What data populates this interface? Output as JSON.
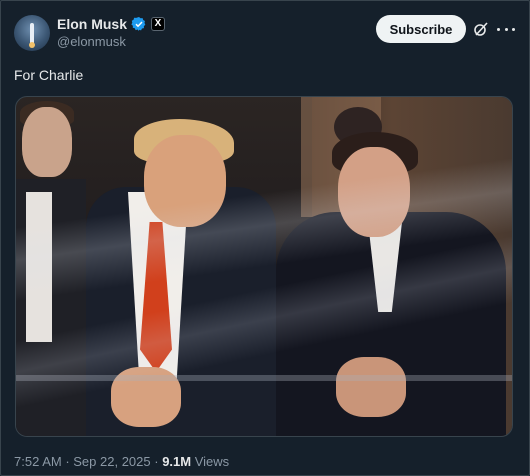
{
  "header": {
    "name": "Elon Musk",
    "handle": "@elonmusk",
    "x_badge": "X",
    "subscribe_label": "Subscribe",
    "icons": [
      "verified-badge-icon",
      "grok-icon",
      "more-icon"
    ],
    "accent_color": "#1d9bf0"
  },
  "tweet": {
    "text": "For Charlie"
  },
  "meta": {
    "time": "7:52 AM",
    "separator1": " · ",
    "date": "Sep 22, 2025",
    "separator2": " · ",
    "views_count": "9.1M",
    "views_label": " Views"
  }
}
